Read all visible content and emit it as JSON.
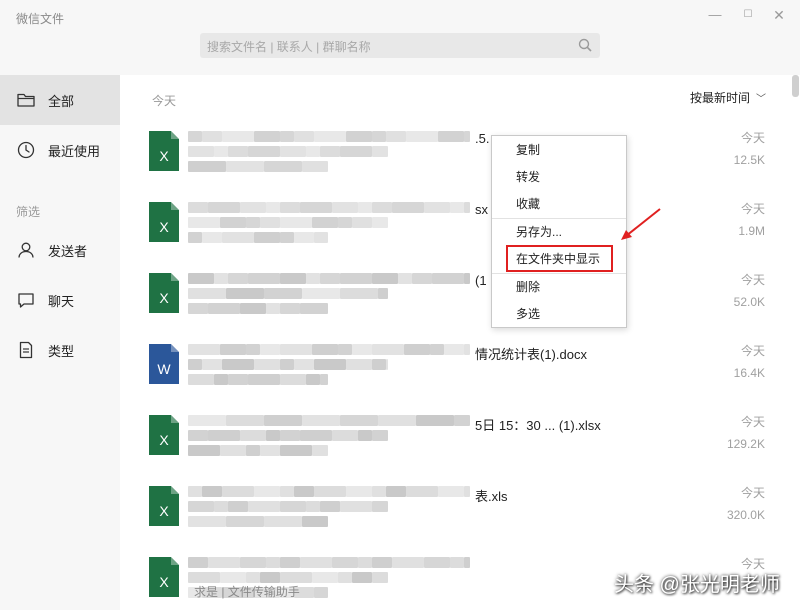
{
  "window": {
    "title": "微信文件",
    "minimize": "—",
    "maximize": "☐",
    "close": "✕"
  },
  "search": {
    "placeholder": "搜索文件名 | 联系人 | 群聊名称"
  },
  "sidebar": {
    "items": [
      {
        "label": "全部",
        "icon": "folder-icon",
        "active": true
      },
      {
        "label": "最近使用",
        "icon": "clock-icon",
        "active": false
      }
    ],
    "filter_label": "筛选",
    "filters": [
      {
        "label": "发送者",
        "icon": "person-icon"
      },
      {
        "label": "聊天",
        "icon": "chat-icon"
      },
      {
        "label": "类型",
        "icon": "document-icon"
      }
    ]
  },
  "main": {
    "date_header": "今天",
    "sort_label": "按最新时间",
    "sort_caret": "﹀",
    "files": [
      {
        "type": "xlsx",
        "icon_letter": "X",
        "name_tail": ".5.",
        "date": "今天",
        "size": "12.5K",
        "source": ""
      },
      {
        "type": "xlsx",
        "icon_letter": "X",
        "name_tail": "sx",
        "date": "今天",
        "size": "1.9M",
        "source": ""
      },
      {
        "type": "xlsx",
        "icon_letter": "X",
        "name_tail": "(1",
        "date": "今天",
        "size": "52.0K",
        "source": ""
      },
      {
        "type": "docx",
        "icon_letter": "W",
        "name_tail": "情况统计表(1).docx",
        "date": "今天",
        "size": "16.4K",
        "source": ""
      },
      {
        "type": "xlsx",
        "icon_letter": "X",
        "name_tail": "5日 15：30 ... (1).xlsx",
        "date": "今天",
        "size": "129.2K",
        "source": ""
      },
      {
        "type": "xls",
        "icon_letter": "X",
        "name_tail": "表.xls",
        "date": "今天",
        "size": "320.0K",
        "source": ""
      },
      {
        "type": "xlsx",
        "icon_letter": "X",
        "name_tail": "",
        "date": "今天",
        "size": "",
        "source": "求是 | 文件传输助手"
      }
    ]
  },
  "context_menu": {
    "items": [
      "复制",
      "转发",
      "收藏",
      "另存为...",
      "在文件夹中显示",
      "删除",
      "多选"
    ],
    "highlighted": "在文件夹中显示"
  },
  "colors": {
    "excel_green": "#1f7244",
    "word_blue": "#2b579a",
    "highlight_red": "#e02020",
    "sidebar_bg": "#f7f7f7",
    "active_item_bg": "#e3e3e3"
  },
  "watermark": "头条 @张光明老师"
}
